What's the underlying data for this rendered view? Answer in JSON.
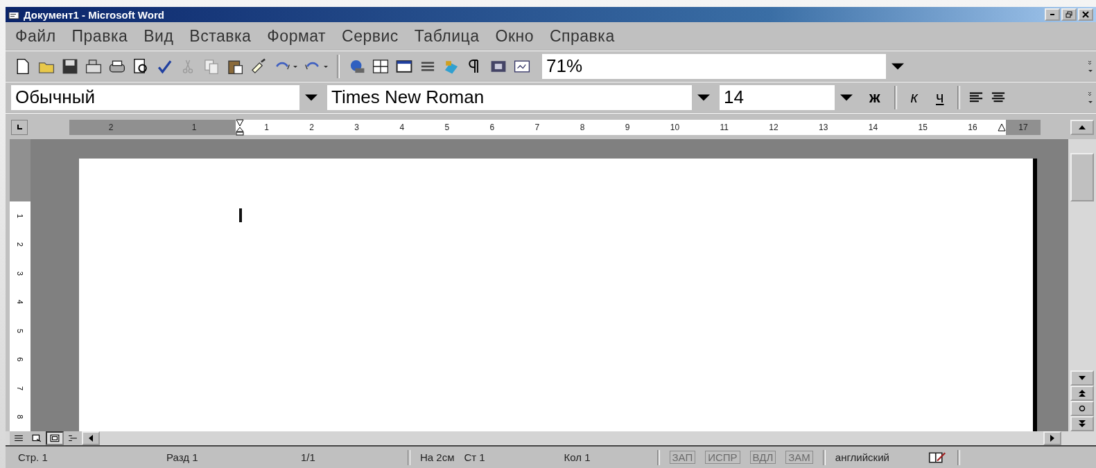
{
  "window": {
    "title": "Документ1 - Microsoft Word"
  },
  "menu": [
    "Файл",
    "Правка",
    "Вид",
    "Вставка",
    "Формат",
    "Сервис",
    "Таблица",
    "Окно",
    "Справка"
  ],
  "standard_toolbar": {
    "zoom": "71%"
  },
  "formatting_toolbar": {
    "style": "Обычный",
    "font": "Times New Roman",
    "size": "14",
    "buttons": [
      "ж",
      "к",
      "ч"
    ]
  },
  "ruler": {
    "left_margin_labels": [
      "2",
      "1"
    ],
    "labels": [
      "1",
      "2",
      "3",
      "4",
      "5",
      "6",
      "7",
      "8",
      "9",
      "10",
      "11",
      "12",
      "13",
      "14",
      "15",
      "16"
    ],
    "right_margin_labels": [
      "17"
    ]
  },
  "vertical_ruler": {
    "labels": [
      "1",
      "2",
      "3",
      "4",
      "5",
      "6",
      "7",
      "8"
    ]
  },
  "view_buttons": [
    {
      "selected": false
    },
    {
      "selected": false
    },
    {
      "selected": true
    },
    {
      "selected": false
    }
  ],
  "status_bar": [
    {
      "text": "Стр. 1",
      "disabled": false
    },
    {
      "text": "Разд 1",
      "disabled": false
    },
    {
      "text": "1/1",
      "disabled": false
    },
    {
      "text": "На 2см",
      "disabled": false
    },
    {
      "text": "Ст 1",
      "disabled": false
    },
    {
      "text": "Кол 1",
      "disabled": false
    },
    {
      "text": "ЗАП",
      "disabled": true
    },
    {
      "text": "ИСПР",
      "disabled": true
    },
    {
      "text": "ВДЛ",
      "disabled": true
    },
    {
      "text": "ЗАМ",
      "disabled": true
    },
    {
      "text": "английский",
      "disabled": false
    }
  ]
}
